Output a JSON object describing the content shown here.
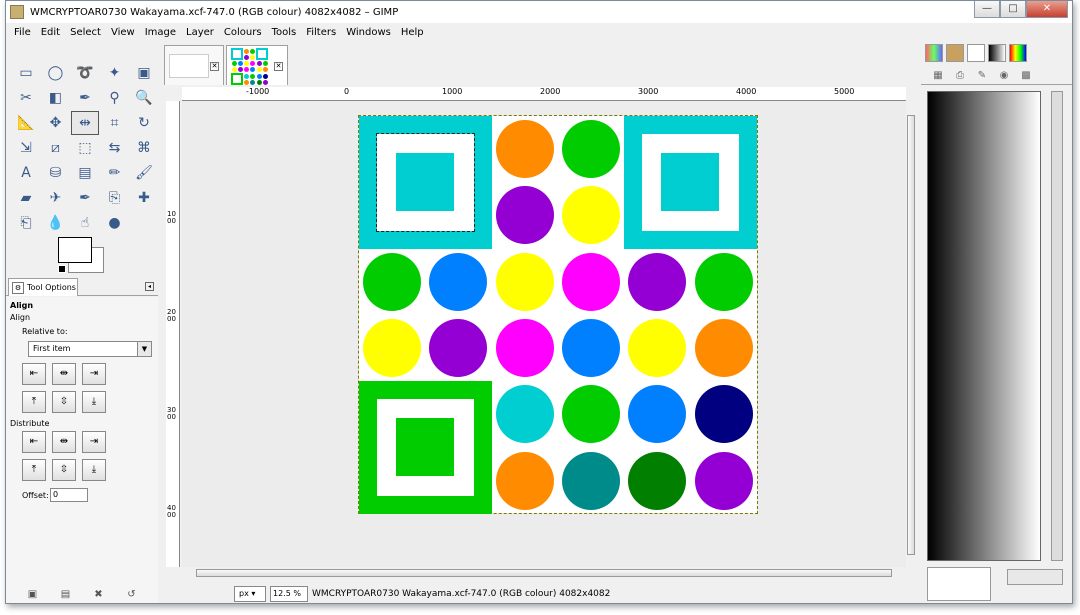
{
  "window": {
    "title": "WMCRYPTOAR0730 Wakayama.xcf-747.0 (RGB colour) 4082x4082 – GIMP",
    "minimize": "—",
    "maximize": "□",
    "close": "✕"
  },
  "menu": [
    "File",
    "Edit",
    "Select",
    "View",
    "Image",
    "Layer",
    "Colours",
    "Tools",
    "Filters",
    "Windows",
    "Help"
  ],
  "tools": [
    "rect-select",
    "ellipse-select",
    "free-select",
    "fuzzy-select",
    "select-by-color",
    "scissors",
    "foreground-select",
    "paths",
    "color-picker",
    "zoom",
    "measure",
    "move",
    "align",
    "crop",
    "rotate",
    "scale",
    "shear",
    "perspective",
    "flip",
    "cage",
    "text",
    "bucket-fill",
    "blend",
    "pencil",
    "paintbrush",
    "eraser",
    "airbrush",
    "ink",
    "clone",
    "heal",
    "perspective-clone",
    "blur",
    "smudge",
    "dodge-burn"
  ],
  "tool_options": {
    "tab_label": "Tool Options",
    "heading": "Align",
    "subheading": "Align",
    "relative_label": "Relative to:",
    "relative_value": "First item",
    "distribute_label": "Distribute",
    "offset_label": "Offset:",
    "offset_value": "0"
  },
  "rulers": {
    "horizontal": [
      "-1000",
      "0",
      "1000",
      "2000",
      "3000",
      "4000",
      "5000"
    ],
    "vertical": [
      "1000",
      "2000",
      "3000",
      "4000"
    ]
  },
  "status": {
    "unit": "px",
    "zoom": "12.5 %",
    "text": "WMCRYPTOAR0730 Wakayama.xcf-747.0 (RGB colour) 4082x4082"
  },
  "colors": {
    "cyan": "#00ced1",
    "orange": "#ff8c00",
    "green": "#00cc00",
    "purple": "#9400d3",
    "yellow": "#ffff00",
    "magenta": "#ff00ff",
    "blue": "#0080ff",
    "navy": "#000080",
    "teal": "#008b8b",
    "darkgreen": "#007f00"
  },
  "circles": [
    {
      "r": 0,
      "c": 2,
      "color": "orange"
    },
    {
      "r": 0,
      "c": 3,
      "color": "green"
    },
    {
      "r": 1,
      "c": 2,
      "color": "purple"
    },
    {
      "r": 1,
      "c": 3,
      "color": "yellow"
    },
    {
      "r": 2,
      "c": 0,
      "color": "green"
    },
    {
      "r": 2,
      "c": 1,
      "color": "blue"
    },
    {
      "r": 2,
      "c": 2,
      "color": "yellow"
    },
    {
      "r": 2,
      "c": 3,
      "color": "magenta"
    },
    {
      "r": 2,
      "c": 4,
      "color": "purple"
    },
    {
      "r": 2,
      "c": 5,
      "color": "green"
    },
    {
      "r": 3,
      "c": 0,
      "color": "yellow"
    },
    {
      "r": 3,
      "c": 1,
      "color": "purple"
    },
    {
      "r": 3,
      "c": 2,
      "color": "magenta"
    },
    {
      "r": 3,
      "c": 3,
      "color": "blue"
    },
    {
      "r": 3,
      "c": 4,
      "color": "yellow"
    },
    {
      "r": 3,
      "c": 5,
      "color": "orange"
    },
    {
      "r": 4,
      "c": 2,
      "color": "cyan"
    },
    {
      "r": 4,
      "c": 3,
      "color": "green"
    },
    {
      "r": 4,
      "c": 4,
      "color": "blue"
    },
    {
      "r": 4,
      "c": 5,
      "color": "navy"
    },
    {
      "r": 5,
      "c": 2,
      "color": "orange"
    },
    {
      "r": 5,
      "c": 3,
      "color": "teal"
    },
    {
      "r": 5,
      "c": 4,
      "color": "darkgreen"
    },
    {
      "r": 5,
      "c": 5,
      "color": "purple"
    }
  ],
  "squares": [
    {
      "r": 0,
      "c": 0,
      "color": "cyan",
      "selected": true
    },
    {
      "r": 0,
      "c": 4,
      "color": "cyan",
      "selected": false
    },
    {
      "r": 4,
      "c": 0,
      "color": "green",
      "selected": false
    }
  ]
}
